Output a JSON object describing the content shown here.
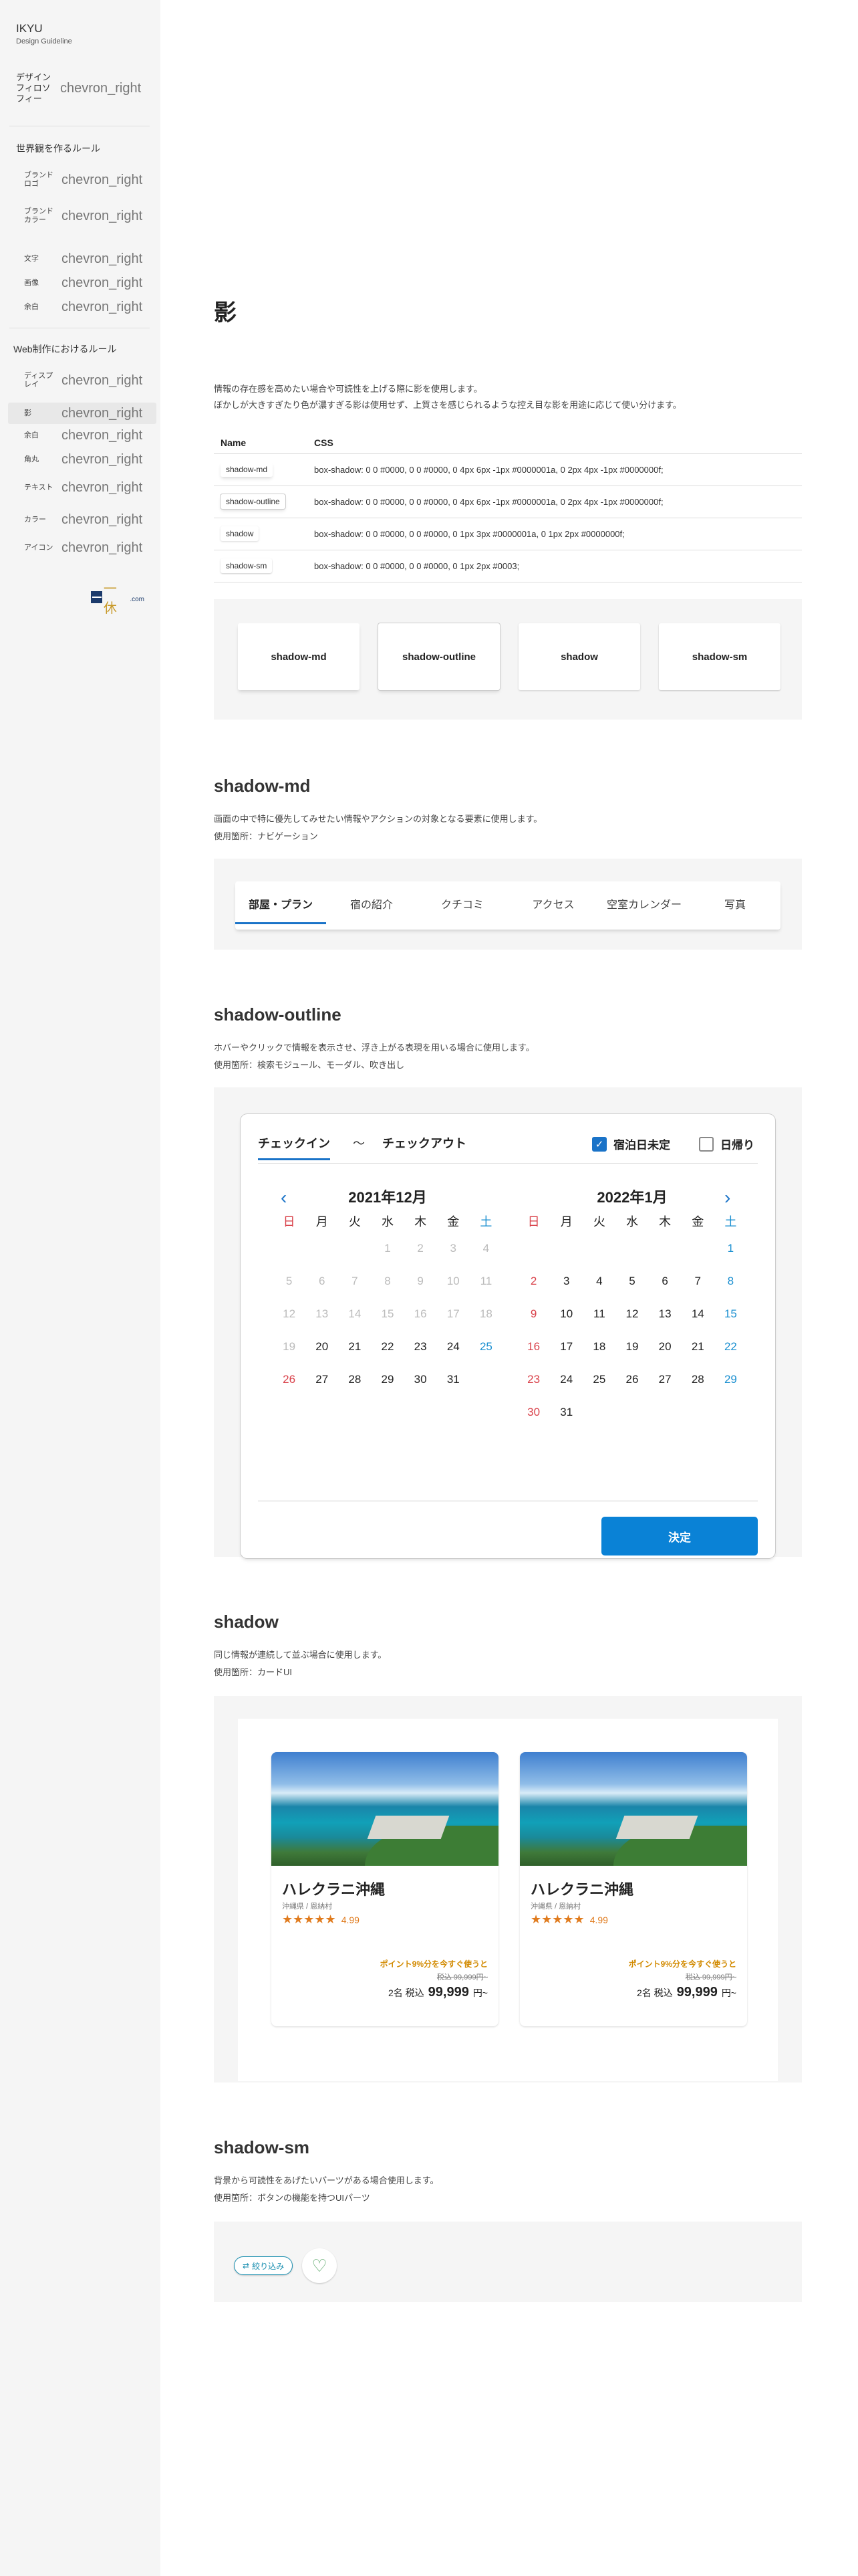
{
  "sidebar": {
    "brand_name": "IKYU",
    "brand_sub": "Design Guideline",
    "design_philosophy": "デザインフィロソフィー",
    "chevron": "chevron_right",
    "group1": "世界観を作るルール",
    "group1_items": [
      "ブランドロゴ",
      "ブランドカラー",
      "文字",
      "画像",
      "余白"
    ],
    "group2": "Web制作におけるルール",
    "group2_items": [
      "ディスプレイ",
      "影",
      "余白",
      "角丸",
      "テキスト",
      "カラー",
      "アイコン"
    ],
    "active_item": "影",
    "logo_text": "一休",
    "logo_com": ".com"
  },
  "main": {
    "title": "影",
    "lead": [
      "情報の存在感を高めたい場合や可読性を上げる際に影を使用します。",
      "ぼかしが大きすぎたり色が濃すぎる影は使用せず、上質さを感じられるような控え目な影を用途に応じて使い分けます。"
    ],
    "table_headers": [
      "Name",
      "CSS"
    ],
    "table_rows": [
      {
        "name": "shadow-md",
        "css": "box-shadow: 0 0 #0000, 0 0 #0000, 0 4px 6px -1px #0000001a, 0 2px 4px -1px #0000000f;"
      },
      {
        "name": "shadow-outline",
        "css": "box-shadow: 0 0 #0000, 0 0 #0000, 0 4px 6px -1px #0000001a, 0 2px 4px -1px #0000000f;"
      },
      {
        "name": "shadow",
        "css": "box-shadow: 0 0 #0000, 0 0 #0000, 0 1px 3px #0000001a, 0 1px 2px #0000000f;"
      },
      {
        "name": "shadow-sm",
        "css": "box-shadow: 0 0 #0000, 0 0 #0000, 0 1px 2px #0003;"
      }
    ],
    "demo_cards": [
      "shadow-md",
      "shadow-outline",
      "shadow",
      "shadow-sm"
    ]
  },
  "sections": {
    "md": {
      "title": "shadow-md",
      "desc": [
        "画面の中で特に優先してみせたい情報やアクションの対象となる要素に使用します。",
        "使用箇所：ナビゲーション"
      ],
      "tabs": [
        "部屋・プラン",
        "宿の紹介",
        "クチコミ",
        "アクセス",
        "空室カレンダー",
        "写真"
      ]
    },
    "outline": {
      "title": "shadow-outline",
      "desc": [
        "ホバーやクリックで情報を表示させ、浮き上がる表現を用いる場合に使用します。",
        "使用箇所：検索モジュール、モーダル、吹き出し"
      ],
      "checkin": "チェックイン",
      "tilde": "〜",
      "checkout": "チェックアウト",
      "undecided": "宿泊日未定",
      "daytrip": "日帰り",
      "prev": "‹",
      "next": "›",
      "weekdays": [
        "日",
        "月",
        "火",
        "水",
        "木",
        "金",
        "土"
      ],
      "months": [
        {
          "title": "2021年12月",
          "offset": 3,
          "days": 31,
          "disabled_until": 20
        },
        {
          "title": "2022年1月",
          "offset": 6,
          "days": 31,
          "disabled_until": 0
        }
      ],
      "decide": "決定"
    },
    "shadow": {
      "title": "shadow",
      "desc": [
        "同じ情報が連続して並ぶ場合に使用します。",
        "使用箇所：カードUI"
      ],
      "cards": [
        {
          "name": "ハレクラニ沖縄",
          "loc": "沖縄県 / 恩納村",
          "stars": "★★★★★",
          "rating": "4.99",
          "point": "ポイント9%分を今すぐ使うと",
          "old": "税込 99,999円~",
          "people": "2名 税込",
          "price": "99,999",
          "unit": "円~"
        },
        {
          "name": "ハレクラニ沖縄",
          "loc": "沖縄県 / 恩納村",
          "stars": "★★★★★",
          "rating": "4.99",
          "point": "ポイント9%分を今すぐ使うと",
          "old": "税込 99,999円~",
          "people": "2名 税込",
          "price": "99,999",
          "unit": "円~"
        }
      ]
    },
    "sm": {
      "title": "shadow-sm",
      "desc": [
        "背景から可読性をあげたいパーツがある場合使用します。",
        "使用箇所：ボタンの機能を持つUIパーツ"
      ],
      "narrow_label": "絞り込み",
      "narrow_icon": "⇄",
      "heart": "♡"
    }
  },
  "colors": {
    "accent": "#1a73c8",
    "sunday": "#d9414a",
    "saturday": "#1a8fd0",
    "rating": "#e07b1e"
  }
}
